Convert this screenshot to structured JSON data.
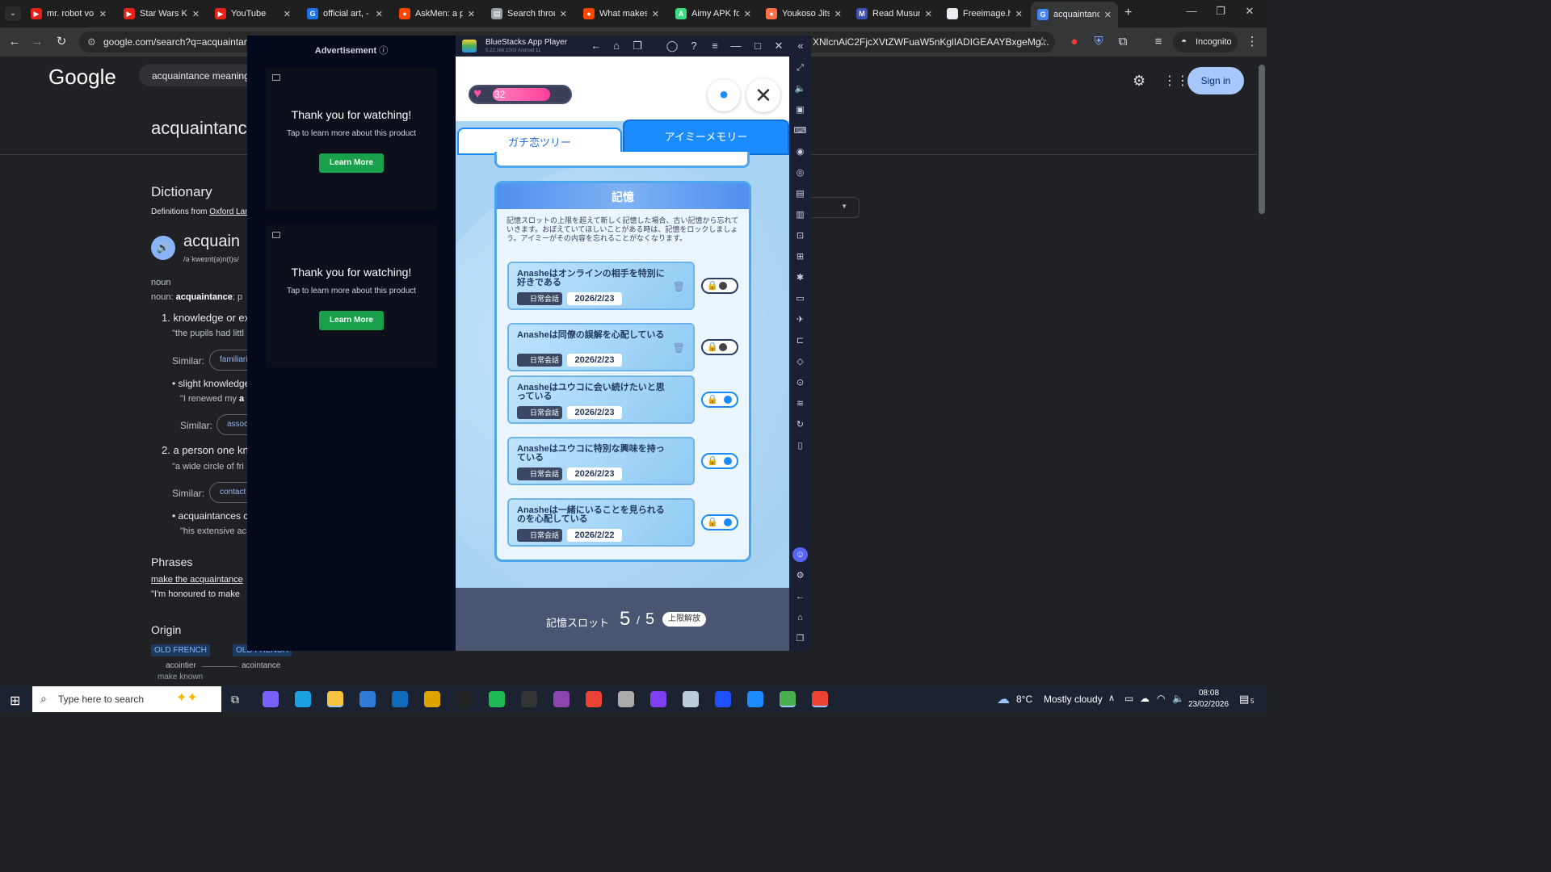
{
  "browser": {
    "tabs": [
      {
        "title": "mr. robot vo",
        "color": "#e62117",
        "glyph": "▶"
      },
      {
        "title": "Star Wars Kn",
        "color": "#e62117",
        "glyph": "▶"
      },
      {
        "title": "YouTube",
        "color": "#e62117",
        "glyph": "▶"
      },
      {
        "title": "official art, -",
        "color": "#1a73e8",
        "glyph": "G"
      },
      {
        "title": "AskMen: a p",
        "color": "#ff4500",
        "glyph": "●"
      },
      {
        "title": "Search throu",
        "color": "#9aa0a6",
        "glyph": "▤"
      },
      {
        "title": "What makes",
        "color": "#ff4500",
        "glyph": "●"
      },
      {
        "title": "Aimy APK fo",
        "color": "#3ddc84",
        "glyph": "A"
      },
      {
        "title": "Youkoso Jits",
        "color": "#ff7043",
        "glyph": "●"
      },
      {
        "title": "Read Musum",
        "color": "#3f51b5",
        "glyph": "M"
      },
      {
        "title": "Freeimage.h",
        "color": "#e8eaed",
        "glyph": "□"
      },
      {
        "title": "acquaintanc",
        "color": "#4285f4",
        "glyph": "G"
      }
    ],
    "address": "google.com/search?q=acquaintanc",
    "address_tail": "XNlcnAiC2FjcXVtZWFuaW5nKglIADIGEAAYBxgeMg...",
    "incognito_label": "Incognito"
  },
  "google": {
    "logo": "Google",
    "search_query": "acquaintance meaning",
    "heading": "acquaintanc",
    "sign_in": "Sign in",
    "dictionary": "Dictionary",
    "definitions_from": "Definitions from",
    "source": "Oxford Lan",
    "word": "acquain",
    "phonetic": "/əˈkweɪnt(ə)n(t)s/",
    "pos1": "noun",
    "pos2_prefix": "noun: ",
    "pos2_bold": "acquaintance",
    "pos2_suffix": "; p",
    "def1": "1. knowledge or ex",
    "ex1": "\"the pupils had littl",
    "similar": "Similar:",
    "sim1": "familiari",
    "sub1": "slight knowledge",
    "ex1b_prefix": "\"I renewed my ",
    "ex1b_bold": "a",
    "sim2": "assoc",
    "def2": "2. a person one kn",
    "ex2": "\"a wide circle of fri",
    "sim3": "contact",
    "sub2": "acquaintances c",
    "ex2b": "\"his extensive ac",
    "phrases": "Phrases",
    "phrase1": "make the acquaintance",
    "phrase1_ex": "\"I'm honoured to make",
    "origin": "Origin",
    "origin_tag1": "OLD FRENCH",
    "origin_tag2": "OLD FRENCH",
    "origin_word1": "acointier",
    "origin_word2": "acointance",
    "origin_gloss": "make known"
  },
  "ad": {
    "label": "Advertisement",
    "cards": [
      {
        "title": "Thank you for watching!",
        "subtitle": "Tap to learn more about this product",
        "button": "Learn More"
      },
      {
        "title": "Thank you for watching!",
        "subtitle": "Tap to learn more about this product",
        "button": "Learn More"
      }
    ]
  },
  "bluestacks": {
    "title": "BlueStacks App Player",
    "version": "5.22.166.1003  Android 11"
  },
  "game": {
    "heart_count": "32",
    "heart_fill": 0.6,
    "tab1": "ガチ恋ツリー",
    "tab2": "アイミーメモリー",
    "panel_title": "記憶",
    "notice": "記憶スロットの上限を超えて新しく記憶した場合、古い記憶から忘れていきます。おぼえていてほしいことがある時は、記憶をロックしましょう。アイミーがその内容を忘れることがなくなります。",
    "memories": [
      {
        "text": "Anasheはオンラインの相手を特別に好きである",
        "tag": "日常会話",
        "date": "2026/2/23",
        "locked": false,
        "deletable": true
      },
      {
        "text": "Anasheは同僚の誤解を心配している",
        "tag": "日常会話",
        "date": "2026/2/23",
        "locked": false,
        "deletable": true
      },
      {
        "text": "Anasheはユウコに会い続けたいと思っている",
        "tag": "日常会話",
        "date": "2026/2/23",
        "locked": true,
        "deletable": false
      },
      {
        "text": "Anasheはユウコに特別な興味を持っている",
        "tag": "日常会話",
        "date": "2026/2/23",
        "locked": true,
        "deletable": false
      },
      {
        "text": "Anasheは一緒にいることを見られるのを心配している",
        "tag": "日常会話",
        "date": "2026/2/22",
        "locked": true,
        "deletable": false
      }
    ],
    "slot_label": "記憶スロット",
    "slot_used": "5",
    "slot_sep": "/",
    "slot_max": "5",
    "unlock_button": "上限解放"
  },
  "taskbar": {
    "search_placeholder": "Type here to search",
    "weather_temp": "8°C",
    "weather_text": "Mostly cloudy",
    "time": "08:08",
    "date": "23/02/2026",
    "notif_count": "5"
  },
  "colors": {
    "accent": "#1a8cff",
    "heart": "#ff4fa0",
    "ad_button": "#19a04a"
  }
}
